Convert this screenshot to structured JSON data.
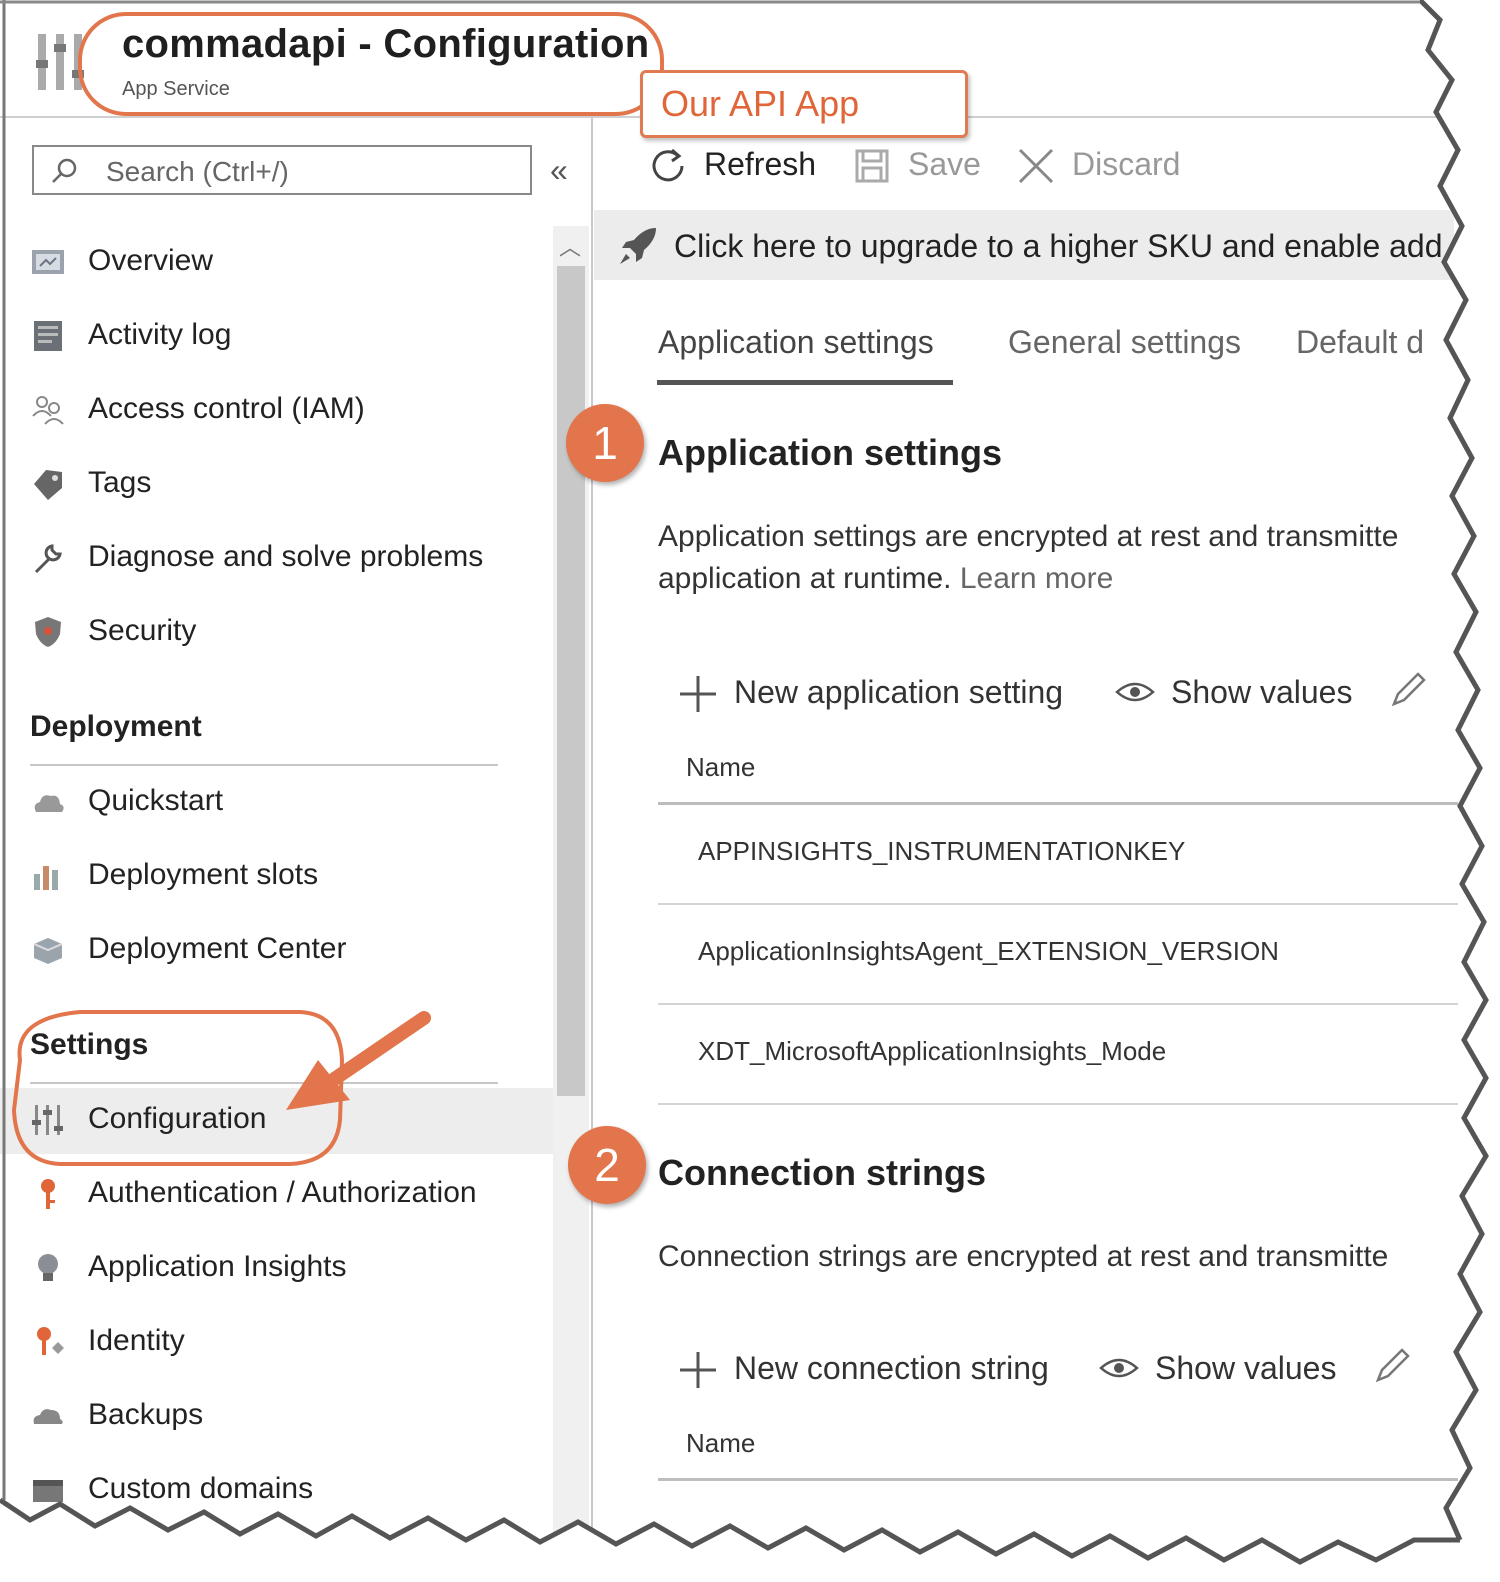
{
  "header": {
    "title": "commadapi - Configuration",
    "subtitle": "App Service"
  },
  "annotation": {
    "callout": "Our API App",
    "badge_1": "1",
    "badge_2": "2",
    "accent_color": "#E2754C"
  },
  "sidebar": {
    "search_placeholder": "Search (Ctrl+/)",
    "collapse_glyph": "«",
    "items_top": [
      {
        "label": "Overview",
        "icon": "overview-icon"
      },
      {
        "label": "Activity log",
        "icon": "activity-log-icon"
      },
      {
        "label": "Access control (IAM)",
        "icon": "people-icon"
      },
      {
        "label": "Tags",
        "icon": "tag-icon"
      },
      {
        "label": "Diagnose and solve problems",
        "icon": "wrench-icon"
      },
      {
        "label": "Security",
        "icon": "shield-icon"
      }
    ],
    "deployment": {
      "heading": "Deployment",
      "items": [
        {
          "label": "Quickstart",
          "icon": "cloud-icon"
        },
        {
          "label": "Deployment slots",
          "icon": "slots-icon"
        },
        {
          "label": "Deployment Center",
          "icon": "deployment-center-icon"
        }
      ]
    },
    "settings": {
      "heading": "Settings",
      "items": [
        {
          "label": "Configuration",
          "icon": "sliders-icon",
          "active": true
        },
        {
          "label": "Authentication / Authorization",
          "icon": "key-icon"
        },
        {
          "label": "Application Insights",
          "icon": "lightbulb-icon"
        },
        {
          "label": "Identity",
          "icon": "identity-key-icon"
        },
        {
          "label": "Backups",
          "icon": "backup-cloud-icon"
        },
        {
          "label": "Custom domains",
          "icon": "domains-icon"
        }
      ]
    }
  },
  "toolbar": {
    "refresh": "Refresh",
    "save": "Save",
    "discard": "Discard"
  },
  "banner": {
    "text": "Click here to upgrade to a higher SKU and enable add"
  },
  "tabs": [
    {
      "label": "Application settings",
      "active": true
    },
    {
      "label": "General settings"
    },
    {
      "label": "Default d"
    }
  ],
  "app_settings": {
    "heading": "Application settings",
    "desc_line1": "Application settings are encrypted at rest and transmitte",
    "desc_line2": "application at runtime.",
    "learn_more": "Learn more",
    "new_label": "New application setting",
    "show_values": "Show values",
    "col_name": "Name",
    "rows": [
      "APPINSIGHTS_INSTRUMENTATIONKEY",
      "ApplicationInsightsAgent_EXTENSION_VERSION",
      "XDT_MicrosoftApplicationInsights_Mode"
    ]
  },
  "conn_strings": {
    "heading": "Connection strings",
    "desc_line1": "Connection strings are encrypted at rest and transmitte",
    "new_label": "New connection string",
    "show_values": "Show values",
    "col_name": "Name"
  }
}
